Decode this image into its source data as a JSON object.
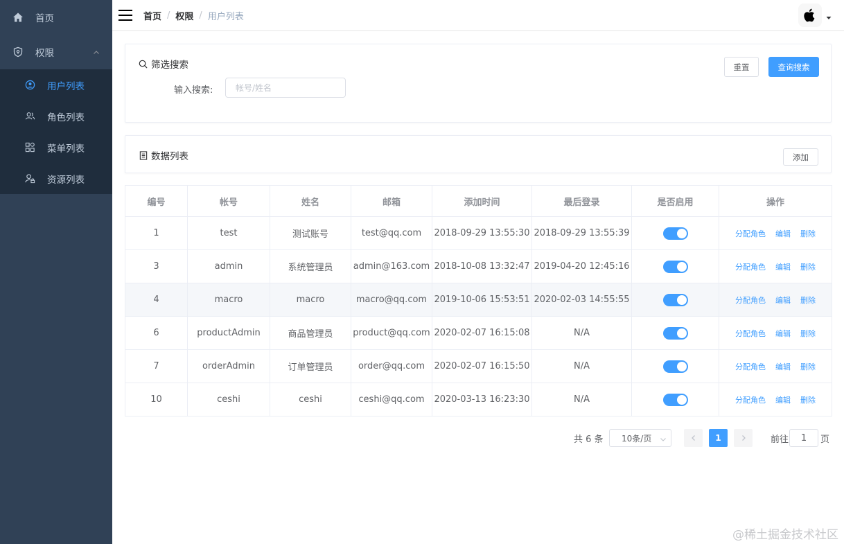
{
  "sidebar": {
    "home": "首页",
    "permission": "权限",
    "items": [
      {
        "label": "用户列表",
        "active": true
      },
      {
        "label": "角色列表"
      },
      {
        "label": "菜单列表"
      },
      {
        "label": "资源列表"
      }
    ]
  },
  "navbar": {
    "breadcrumb": [
      "首页",
      "权限",
      "用户列表"
    ]
  },
  "filter": {
    "title": "筛选搜索",
    "label": "输入搜索:",
    "placeholder": "帐号/姓名",
    "reset": "重置",
    "query": "查询搜索"
  },
  "list": {
    "title": "数据列表",
    "add": "添加"
  },
  "table": {
    "headers": [
      "编号",
      "帐号",
      "姓名",
      "邮箱",
      "添加时间",
      "最后登录",
      "是否启用",
      "操作"
    ],
    "actions": [
      "分配角色",
      "编辑",
      "删除"
    ],
    "rows": [
      {
        "id": "1",
        "account": "test",
        "name": "测试账号",
        "email": "test@qq.com",
        "created": "2018-09-29 13:55:30",
        "last_login": "2018-09-29 13:55:39",
        "enabled": true
      },
      {
        "id": "3",
        "account": "admin",
        "name": "系统管理员",
        "email": "admin@163.com",
        "created": "2018-10-08 13:32:47",
        "last_login": "2019-04-20 12:45:16",
        "enabled": true
      },
      {
        "id": "4",
        "account": "macro",
        "name": "macro",
        "email": "macro@qq.com",
        "created": "2019-10-06 15:53:51",
        "last_login": "2020-02-03 14:55:55",
        "enabled": true
      },
      {
        "id": "6",
        "account": "productAdmin",
        "name": "商品管理员",
        "email": "product@qq.com",
        "created": "2020-02-07 16:15:08",
        "last_login": "N/A",
        "enabled": true
      },
      {
        "id": "7",
        "account": "orderAdmin",
        "name": "订单管理员",
        "email": "order@qq.com",
        "created": "2020-02-07 16:15:50",
        "last_login": "N/A",
        "enabled": true
      },
      {
        "id": "10",
        "account": "ceshi",
        "name": "ceshi",
        "email": "ceshi@qq.com",
        "created": "2020-03-13 16:23:30",
        "last_login": "N/A",
        "enabled": true
      }
    ]
  },
  "pagination": {
    "total": "共 6 条",
    "page_size": "10条/页",
    "current_page": "1",
    "goto_label": "前往",
    "goto_value": "1",
    "goto_suffix": "页"
  },
  "watermark": "@稀土掘金技术社区",
  "colors": {
    "sidebar_bg": "#304156",
    "submenu_bg": "#1f2d3d",
    "primary": "#409eff"
  }
}
